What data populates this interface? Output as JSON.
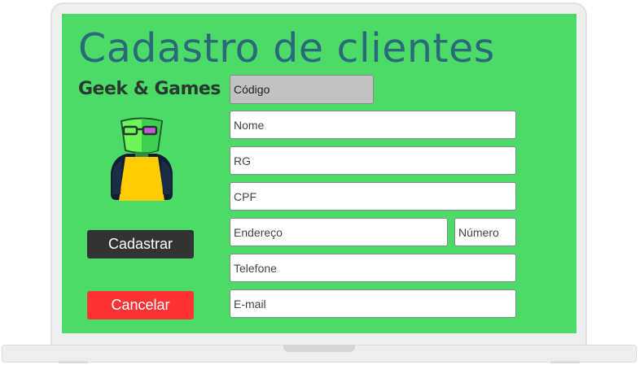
{
  "page": {
    "title": "Cadastro de clientes",
    "brand": "Geek & Games"
  },
  "form": {
    "codigo_placeholder": "Código",
    "nome_placeholder": "Nome",
    "rg_placeholder": "RG",
    "cpf_placeholder": "CPF",
    "endereco_placeholder": "Endereço",
    "numero_placeholder": "Número",
    "telefone_placeholder": "Telefone",
    "email_placeholder": "E-mail"
  },
  "buttons": {
    "save_label": "Cadastrar",
    "cancel_label": "Cancelar"
  },
  "icons": {
    "mascot": "geek-mascot-icon"
  },
  "colors": {
    "screen_bg": "#4cdb69",
    "title": "#2b6a78",
    "save_button": "#333333",
    "cancel_button": "#ff3333",
    "code_field_bg": "#c2c2c2"
  }
}
